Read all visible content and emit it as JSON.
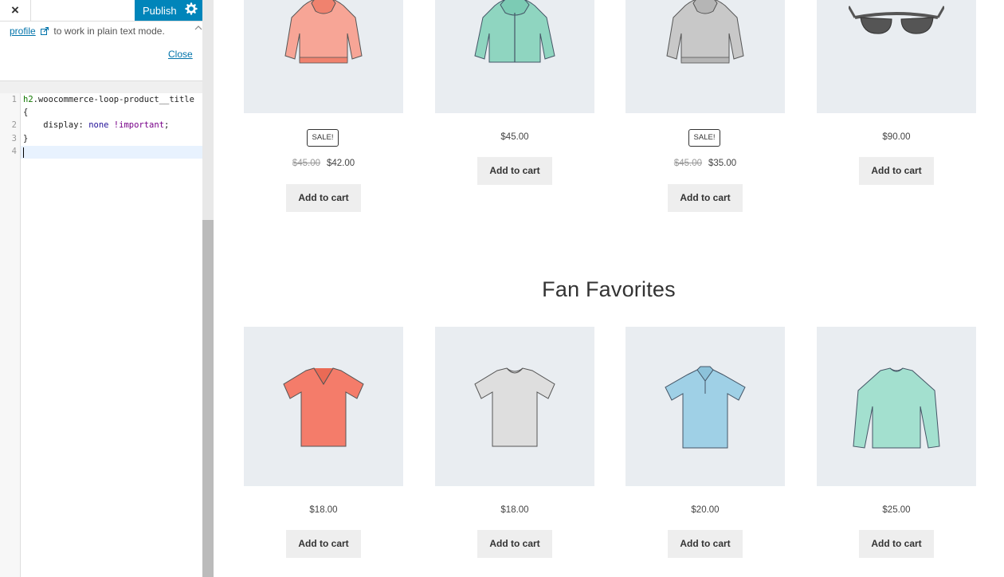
{
  "customizer": {
    "close_label": "×",
    "publish_label": "Publish",
    "settings_icon": "gear-icon",
    "notice": {
      "link_text": "profile",
      "text": "to work in plain text mode.",
      "close_text": "Close"
    },
    "editor": {
      "lines": [
        {
          "num": "1",
          "parts": [
            {
              "t": "h2",
              "c": "t-tag"
            },
            {
              "t": ".woocommerce-loop-product__title",
              "c": "t-prop"
            }
          ]
        },
        {
          "num": "",
          "parts": [
            {
              "t": "{",
              "c": "t-prop"
            }
          ]
        },
        {
          "num": "2",
          "parts": [
            {
              "t": "    display: ",
              "c": "t-prop"
            },
            {
              "t": "none",
              "c": "t-val"
            },
            {
              "t": " !important",
              "c": "t-kw"
            },
            {
              "t": ";",
              "c": "t-prop"
            }
          ]
        },
        {
          "num": "3",
          "parts": [
            {
              "t": "}",
              "c": "t-prop"
            }
          ]
        },
        {
          "num": "4",
          "parts": []
        }
      ]
    }
  },
  "preview": {
    "row1": [
      {
        "image": "hoodie-coral",
        "sale_badge": "SALE!",
        "old_price": "$45.00",
        "price": "$42.00",
        "button": "Add to cart"
      },
      {
        "image": "hoodie-zip-mint",
        "sale_badge": "",
        "old_price": "",
        "price": "$45.00",
        "button": "Add to cart"
      },
      {
        "image": "hoodie-grey",
        "sale_badge": "SALE!",
        "old_price": "$45.00",
        "price": "$35.00",
        "button": "Add to cart"
      },
      {
        "image": "sunglasses",
        "sale_badge": "",
        "old_price": "",
        "price": "$90.00",
        "button": "Add to cart"
      }
    ],
    "section_title": "Fan Favorites",
    "row2": [
      {
        "image": "tshirt-vneck-coral",
        "price": "$18.00",
        "button": "Add to cart"
      },
      {
        "image": "tshirt-grey",
        "price": "$18.00",
        "button": "Add to cart"
      },
      {
        "image": "polo-blue",
        "price": "$20.00",
        "button": "Add to cart"
      },
      {
        "image": "longsleeve-mint",
        "price": "$25.00",
        "button": "Add to cart"
      }
    ]
  }
}
